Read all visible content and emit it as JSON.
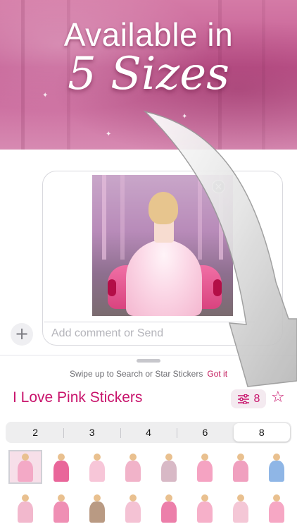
{
  "banner": {
    "line1": "Available in",
    "line2": "5 Sizes"
  },
  "compose": {
    "placeholder": "Add comment or Send",
    "close_glyph": "×",
    "plus_glyph": "+"
  },
  "hint": {
    "text": "Swipe up to Search or Star Stickers",
    "action": "Got it"
  },
  "pack": {
    "title": "I Love Pink Stickers",
    "size_count": "8",
    "size_icon": "sliders-icon",
    "star_icon": "star-outline-icon",
    "star_glyph": "☆"
  },
  "sizes": {
    "options": [
      "2",
      "3",
      "4",
      "6",
      "8"
    ],
    "selected": "8"
  },
  "colors": {
    "accent": "#c8146c",
    "banner": "#c45b92"
  }
}
